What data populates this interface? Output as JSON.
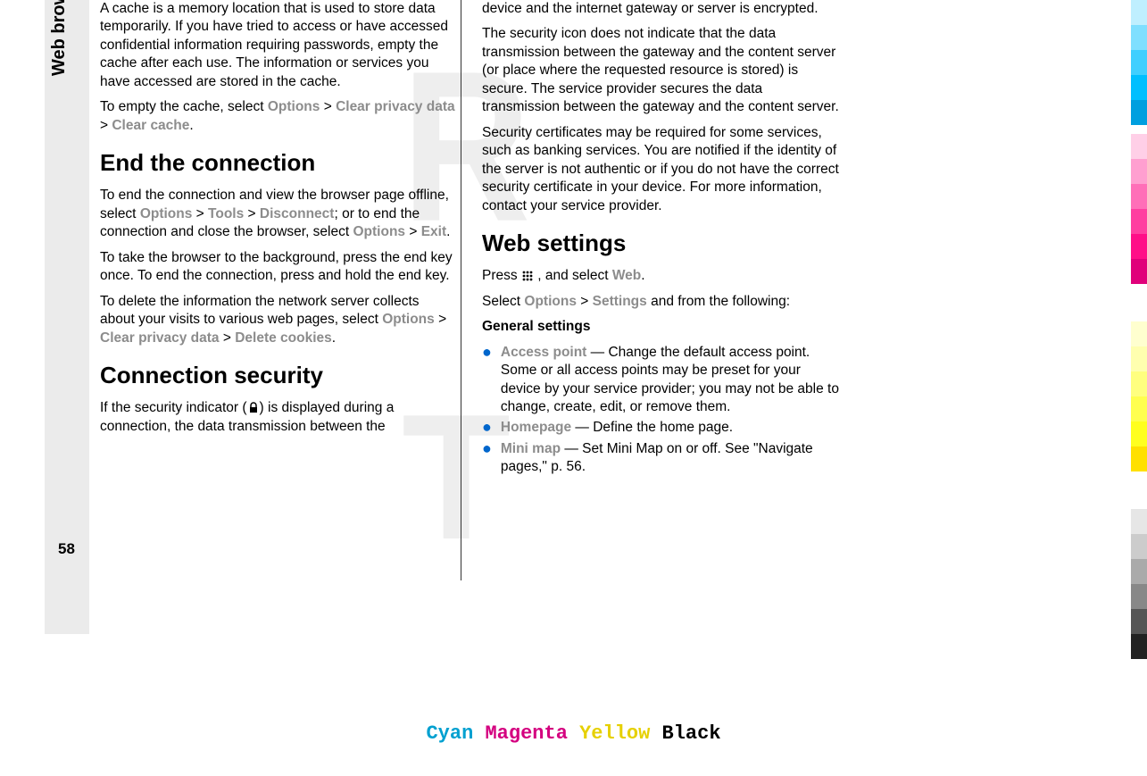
{
  "sidebar": {
    "section_label": "Web browser",
    "page_number": "58"
  },
  "col1": {
    "p1": "A cache is a memory location that is used to store data temporarily. If you have tried to access or have accessed confidential information requiring passwords, empty the cache after each use. The information or services you have accessed are stored in the cache.",
    "p2_prefix": "To empty the cache, select ",
    "p2_opt1": "Options",
    "p2_gt1": " > ",
    "p2_opt2": "Clear privacy data",
    "p2_gt2": " > ",
    "p2_opt3": "Clear cache",
    "p2_suffix": ".",
    "h1": "End the connection",
    "p3_prefix": "To end the connection and view the browser page offline, select ",
    "p3_opt1": "Options",
    "p3_gt1": " > ",
    "p3_opt2": "Tools",
    "p3_gt2": " > ",
    "p3_opt3": "Disconnect",
    "p3_mid": "; or to end the connection and close the browser, select ",
    "p3_opt4": "Options",
    "p3_gt3": " > ",
    "p3_opt5": "Exit",
    "p3_suffix": ".",
    "p4": "To take the browser to the background, press the end key once. To end the connection, press and hold the end key.",
    "p5_prefix": "To delete the information the network server collects about your visits to various web pages, select ",
    "p5_opt1": "Options",
    "p5_gt1": " > ",
    "p5_opt2": "Clear privacy data",
    "p5_gt2": " > ",
    "p5_opt3": "Delete cookies",
    "p5_suffix": ".",
    "h2": "Connection security",
    "p6_prefix": "If the security indicator (",
    "p6_suffix": ") is displayed during a connection, the data transmission between the"
  },
  "col2": {
    "p1": "device and the internet gateway or server is encrypted.",
    "p2": "The security icon does not indicate that the data transmission between the gateway and the content server (or place where the requested resource is stored) is secure. The service provider secures the data transmission between the gateway and the content server.",
    "p3": "Security certificates may be required for some services, such as banking services. You are notified if the identity of the server is not authentic or if you do not have the correct security certificate in your device. For more information, contact your service provider.",
    "h1": "Web settings",
    "p4_prefix": "Press ",
    "p4_mid": " , and select ",
    "p4_opt": "Web",
    "p4_suffix": ".",
    "p5_prefix": "Select ",
    "p5_opt1": "Options",
    "p5_gt": " > ",
    "p5_opt2": "Settings",
    "p5_suffix": " and from the following:",
    "general_label": "General settings",
    "bullets": [
      {
        "label": "Access point",
        "text": " — Change the default access point. Some or all access points may be preset for your device by your service provider; you may not be able to change, create, edit, or remove them."
      },
      {
        "label": "Homepage",
        "text": " — Define the home page."
      },
      {
        "label": "Mini map",
        "text": " — Set Mini Map on or off. See \"Navigate pages,\" p. 56."
      }
    ]
  },
  "footer": {
    "cyan": "Cyan",
    "magenta": "Magenta",
    "yellow": "Yellow",
    "black": "Black"
  }
}
